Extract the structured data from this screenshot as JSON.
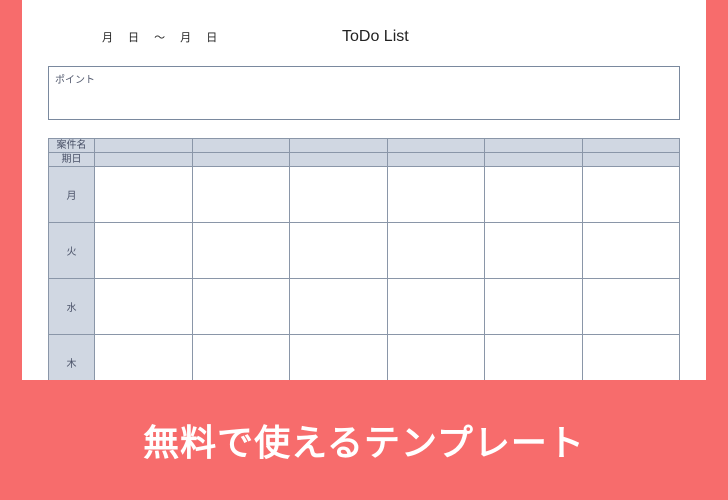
{
  "header": {
    "date_range": "月 日 ～  月 日",
    "title": "ToDo List"
  },
  "point_box": {
    "label": "ポイント"
  },
  "grid": {
    "row_header_top": "案件名",
    "row_header_bottom": "期日",
    "columns": [
      "",
      "",
      "",
      "",
      "",
      ""
    ],
    "days": [
      "月",
      "火",
      "水",
      "木"
    ]
  },
  "banner": {
    "text": "無料で使えるテンプレート"
  }
}
